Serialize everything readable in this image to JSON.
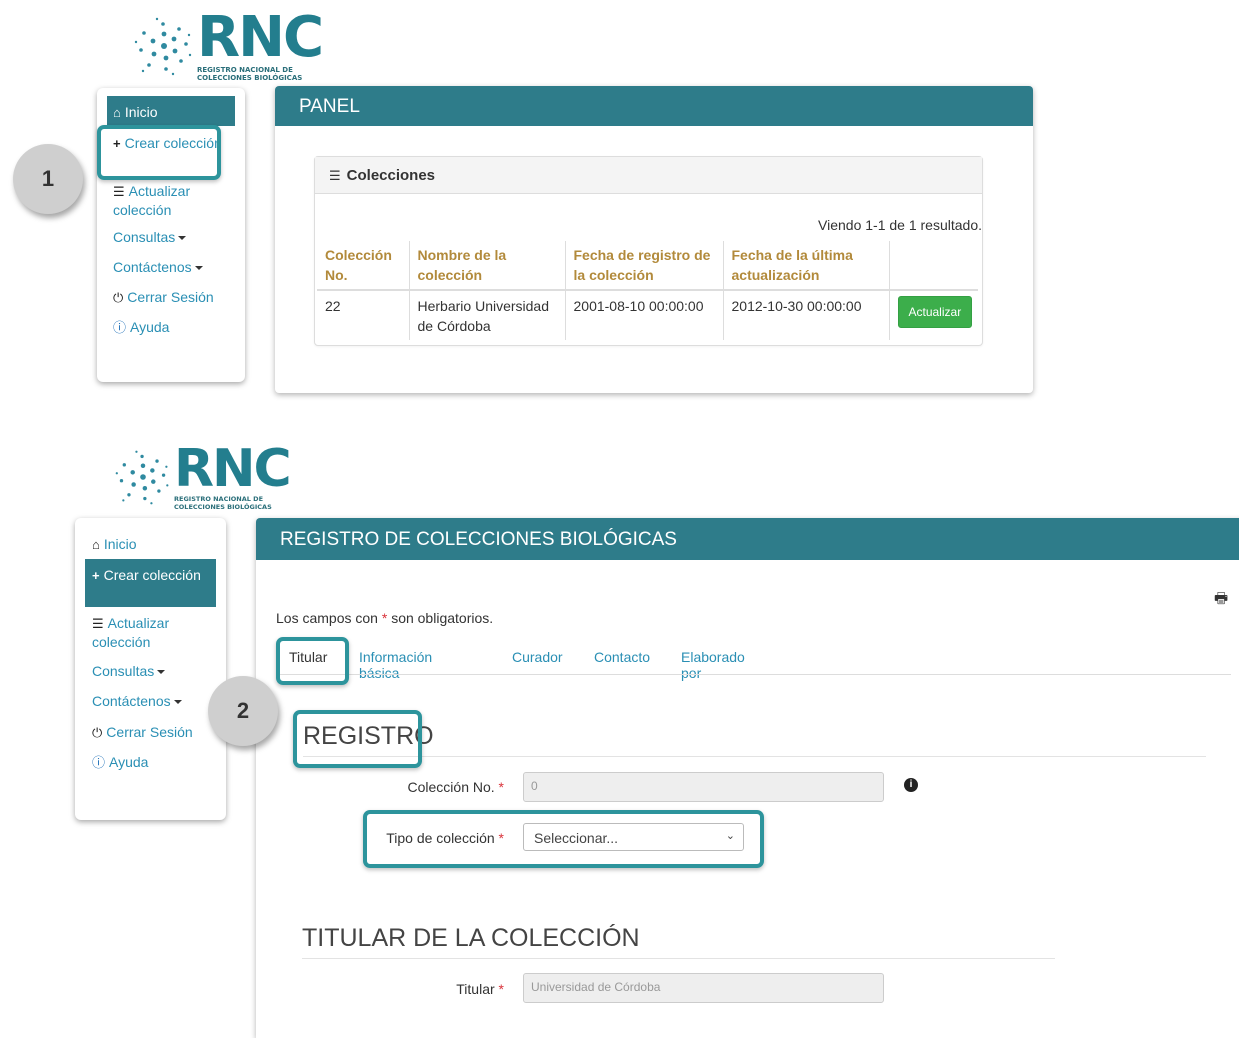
{
  "logo": {
    "wordmark": "RNC",
    "subtitle_line1": "REGISTRO NACIONAL DE",
    "subtitle_line2": "COLECCIONES BIOLÓGICAS",
    "brand_color": "#237e8e"
  },
  "callouts": {
    "step1": "1",
    "step2": "2",
    "highlight_color": "#2d949c"
  },
  "screen1": {
    "nav": {
      "items": [
        {
          "icon": "home-icon",
          "label": "Inicio",
          "active": true
        },
        {
          "icon": "plus-icon",
          "label": "Crear colección"
        },
        {
          "icon": "list-icon",
          "label": "Actualizar colección"
        },
        {
          "label": "Consultas",
          "dropdown": true
        },
        {
          "label": "Contáctenos",
          "dropdown": true
        },
        {
          "icon": "power-icon",
          "label": "Cerrar Sesión"
        },
        {
          "icon": "info-icon",
          "label": "Ayuda"
        }
      ]
    },
    "panel_title": "PANEL",
    "collections": {
      "title": "Colecciones",
      "summary": "Viendo 1-1 de 1 resultado.",
      "columns": [
        "Colección No.",
        "Nombre de la colección",
        "Fecha de registro de la colección",
        "Fecha de la última actualización",
        ""
      ],
      "rows": [
        {
          "no": "22",
          "name": "Herbario Universidad de Córdoba",
          "registered": "2001-08-10 00:00:00",
          "updated": "2012-10-30 00:00:00",
          "action": "Actualizar"
        }
      ]
    }
  },
  "screen2": {
    "nav": {
      "items": [
        {
          "icon": "home-icon",
          "label": "Inicio"
        },
        {
          "icon": "plus-icon",
          "label": "Crear colección",
          "active": true
        },
        {
          "icon": "list-icon",
          "label": "Actualizar colección"
        },
        {
          "label": "Consultas",
          "dropdown": true
        },
        {
          "label": "Contáctenos",
          "dropdown": true
        },
        {
          "icon": "power-icon",
          "label": "Cerrar Sesión"
        },
        {
          "icon": "info-icon",
          "label": "Ayuda"
        }
      ]
    },
    "panel_title": "REGISTRO DE COLECCIONES BIOLÓGICAS",
    "required_note_before": "Los campos con",
    "required_star": "*",
    "required_note_after": "son obligatorios.",
    "tabs": [
      "Titular",
      "Información básica",
      "Curador",
      "Contacto",
      "Elaborado por"
    ],
    "active_tab": "Titular",
    "section_registro": "REGISTRO",
    "field_coleccion_no": {
      "label": "Colección No.",
      "value": "0"
    },
    "field_tipo": {
      "label": "Tipo de colección",
      "selected": "Seleccionar..."
    },
    "section_titular": "TITULAR DE LA COLECCIÓN",
    "field_titular": {
      "label": "Titular",
      "value": "Universidad de Córdoba"
    }
  }
}
